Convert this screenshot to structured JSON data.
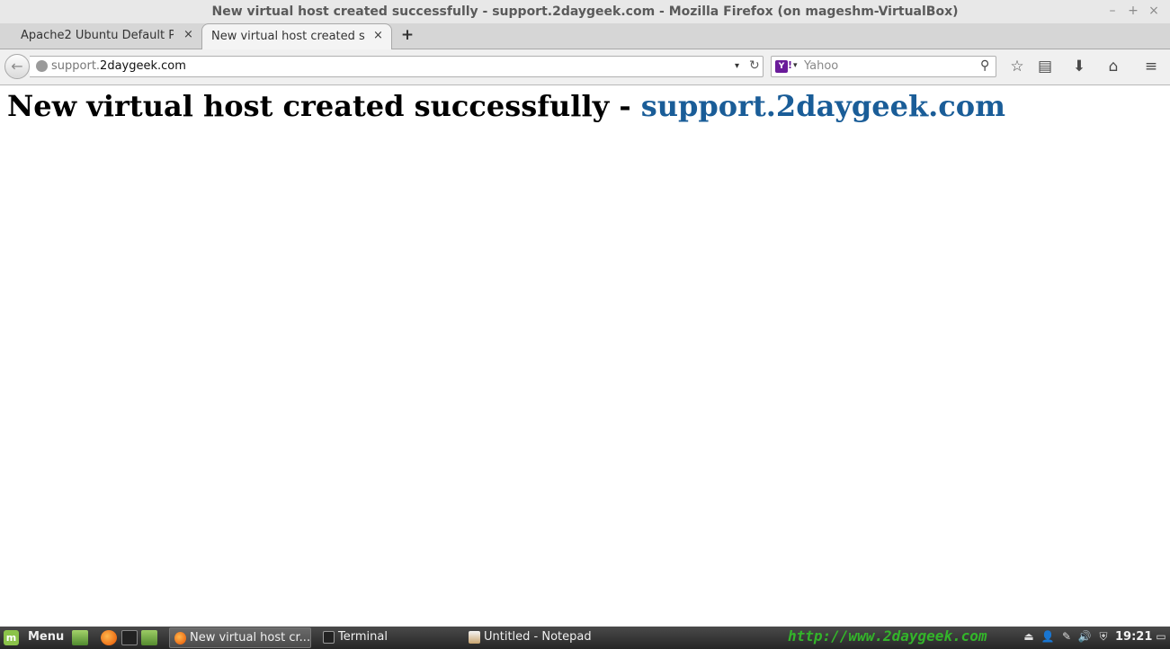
{
  "window": {
    "title": "New virtual host created successfully - support.2daygeek.com - Mozilla Firefox (on mageshm-VirtualBox)",
    "controls": {
      "minimize": "–",
      "maximize": "+",
      "close": "×"
    }
  },
  "tabs": [
    {
      "label": "Apache2 Ubuntu Default P...",
      "active": false,
      "close": "×"
    },
    {
      "label": "New virtual host created s...",
      "active": true,
      "close": "×"
    }
  ],
  "new_tab_glyph": "+",
  "navbar": {
    "back_glyph": "←",
    "url_prefix": "support.",
    "url_domain": "2daygeek.com",
    "dropdown_glyph": "▾",
    "reload_glyph": "↻",
    "search": {
      "engine_icon": "Y",
      "engine_mark": "!",
      "dropdown_glyph": "▾",
      "placeholder": "Yahoo",
      "value": "",
      "search_glyph": "⚲"
    },
    "toolbar": {
      "bookmark_glyph": "☆",
      "bookmarks_menu_glyph": "▤",
      "download_glyph": "⬇",
      "home_glyph": "⌂",
      "menu_glyph": "≡"
    }
  },
  "page": {
    "heading_text": "New virtual host created successfully - ",
    "heading_link": "support.2daygeek.com",
    "link_color": "#1a5d98"
  },
  "taskbar": {
    "menu_label": "Menu",
    "menu_icon": "m",
    "tasks": [
      {
        "label": "New virtual host cr...",
        "icon": "firefox-icon",
        "active": true
      },
      {
        "label": "Terminal",
        "icon": "terminal-icon",
        "active": false
      },
      {
        "label": "Untitled - Notepad",
        "icon": "notepad-icon",
        "active": false
      }
    ],
    "watermark": "http://www.2daygeek.com",
    "clock": "19:21",
    "tray": {
      "network_glyph": "⏏",
      "user_glyph": "👤",
      "tool_glyph": "✎",
      "volume_glyph": "🔊",
      "shield_glyph": "⛨",
      "display_glyph": "▭"
    }
  }
}
